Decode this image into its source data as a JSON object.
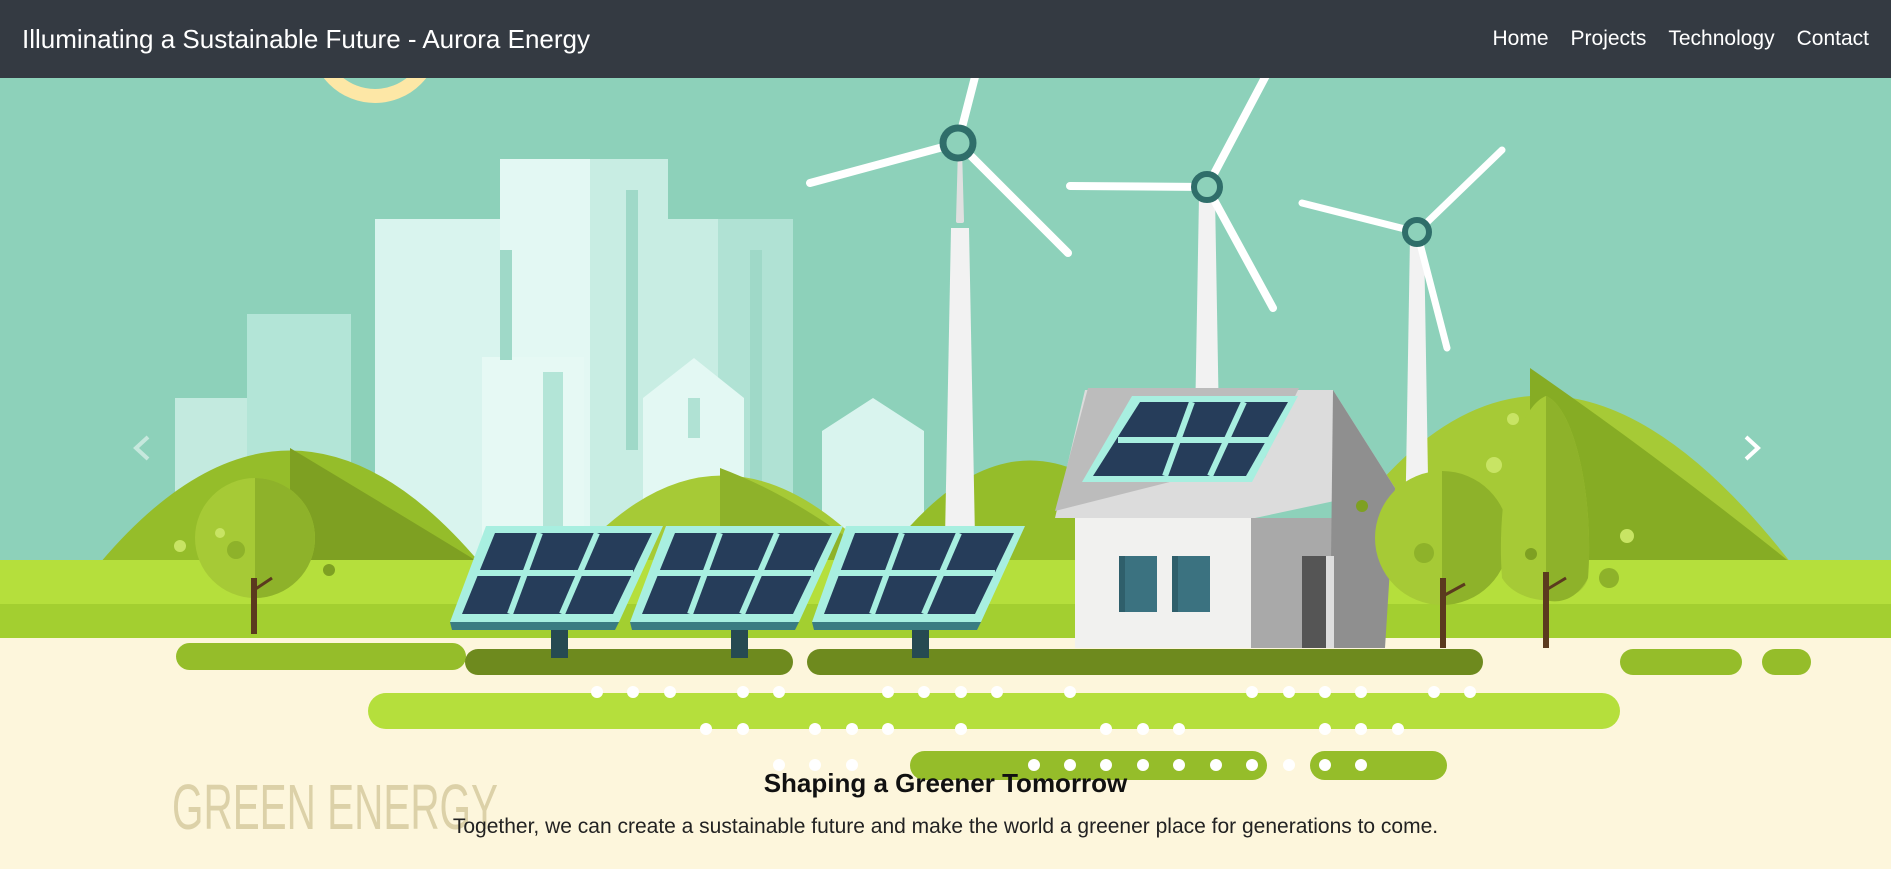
{
  "navbar": {
    "brand": "Illuminating a Sustainable Future - Aurora Energy",
    "links": [
      "Home",
      "Projects",
      "Technology",
      "Contact"
    ]
  },
  "hero": {
    "artwork_text": "GREEN ENERGY",
    "caption_title": "Shaping a Greener Tomorrow",
    "caption_text": "Together, we can create a sustainable future and make the world a greener place for generations to come."
  },
  "carousel": {
    "prev_icon": "chevron-left-icon",
    "next_icon": "chevron-right-icon"
  },
  "colors": {
    "navbar": "#343a42",
    "sky": "#8dd1ba",
    "grass": "#b5df3c",
    "ground": "#fdf6dc",
    "panel": "#263d5a"
  }
}
